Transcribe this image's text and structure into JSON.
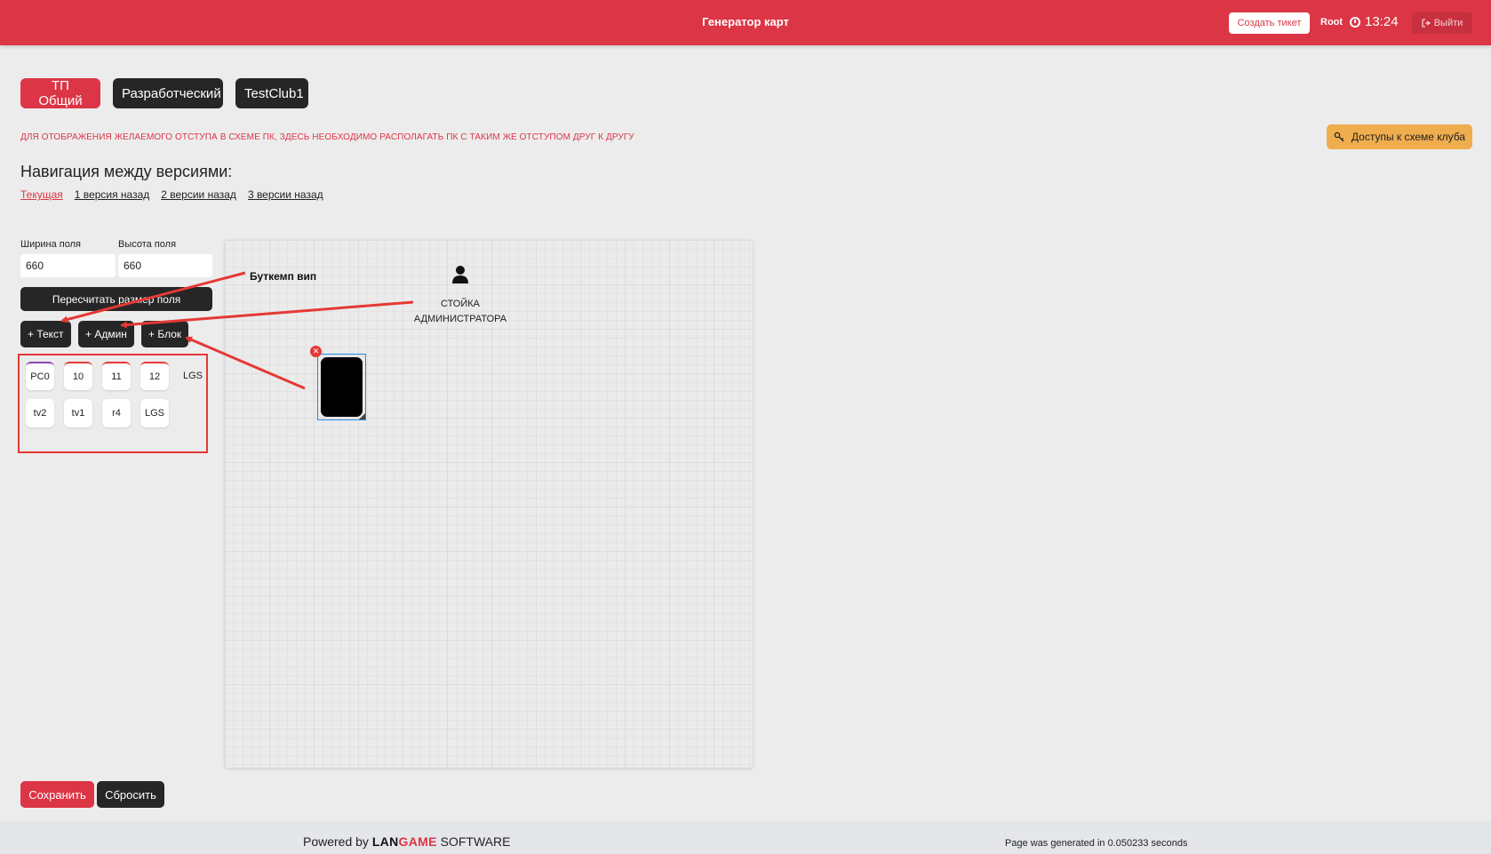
{
  "header": {
    "title": "Генератор карт",
    "create_ticket_label": "Создать тикет",
    "user": "Root",
    "time": "13:24",
    "logout_label": "Выйти"
  },
  "club_tabs": [
    "ТП Общий",
    "Разработческий",
    "TestClub1"
  ],
  "warning": "ДЛЯ ОТОБРАЖЕНИЯ ЖЕЛАЕМОГО ОТСТУПА В СХЕМЕ ПК, ЗДЕСЬ НЕОБХОДИМО РАСПОЛАГАТЬ ПК С ТАКИМ ЖЕ ОТСТУПОМ ДРУГ К ДРУГУ",
  "access_button": "Доступы к схеме клуба",
  "navigation": {
    "title": "Навигация между версиями:",
    "versions": [
      "Текущая",
      "1 версия назад",
      "2 версии назад",
      "3 версии назад"
    ]
  },
  "field": {
    "width_label": "Ширина поля",
    "width_value": "660",
    "height_label": "Высота поля",
    "height_value": "660",
    "recalc_label": "Пересчитать размер поля"
  },
  "add_buttons": [
    "+ Текст",
    "+ Админ",
    "+ Блок"
  ],
  "pc_items": [
    "PC0",
    "10",
    "11",
    "12",
    "LGS",
    "tv2",
    "tv1",
    "r4",
    "LGS"
  ],
  "canvas": {
    "text_label": "Буткемп вип",
    "admin_label_line1": "СТОЙКА",
    "admin_label_line2": "АДМИНИСТРАТОРА",
    "close_glyph": "✕"
  },
  "actions": {
    "save_label": "Сохранить",
    "reset_label": "Сбросить"
  },
  "footer": {
    "powered_prefix": "Powered by",
    "brand_lan": "LAN",
    "brand_game": "GAME",
    "brand_suffix": "SOFTWARE",
    "generated": "Page was generated in 0.050233 seconds"
  },
  "colors": {
    "primary": "#dc3545",
    "dark": "#262626",
    "accent": "#f0ad4e",
    "annotation": "#e53935"
  },
  "icons": {
    "clock": "clock-icon",
    "logout": "sign-out-icon",
    "access": "key-icon",
    "admin": "user-icon"
  }
}
